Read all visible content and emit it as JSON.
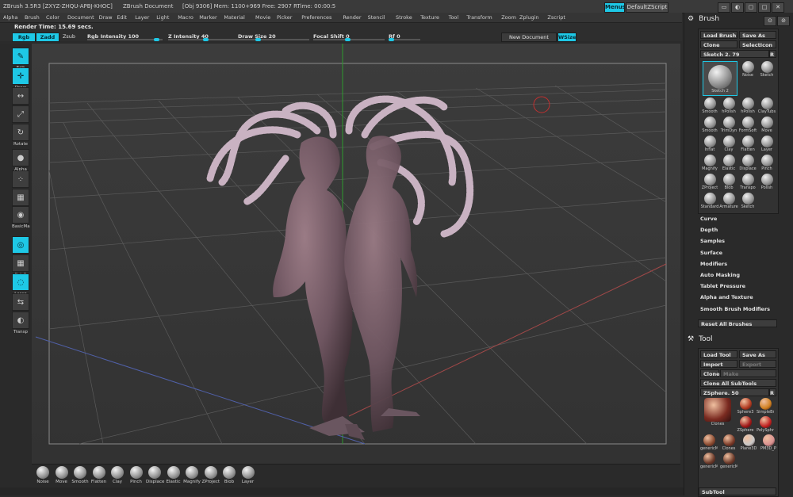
{
  "titlebar": {
    "app": "ZBrush 3.5R3 [ZXYZ-ZHQU-APBJ-KHOC]",
    "doc": "ZBrush Document",
    "stats": "[Obj 9306] Mem: 1100+969 Free: 2907 RTime: 00:00:5",
    "menus_btn": "Menus",
    "script_btn": "DefaultZScript"
  },
  "menubar": [
    "Alpha",
    "Brush",
    "Color",
    "Document",
    "Draw",
    "Edit",
    "Layer",
    "Light",
    "Macro",
    "Marker",
    "Material",
    "Movie",
    "Picker",
    "Preferences",
    "Render",
    "Stencil",
    "Stroke",
    "Texture",
    "Tool",
    "Transform",
    "Zoom",
    "Zplugin",
    "Zscript"
  ],
  "render_time": "Render Time: 15.69 secs.",
  "params": {
    "rgb": "Rgb",
    "zadd": "Zadd",
    "zsub": "Zsub",
    "rgb_intensity": "Rgb Intensity 100",
    "z_intensity": "Z Intensity 40",
    "draw_size": "Draw Size 20",
    "focal_shift": "Focal Shift 0",
    "rf": "Rf 0",
    "new_document": "New Document",
    "wsize": "WSize"
  },
  "lefttools": [
    {
      "label": "Edit",
      "icon": "edit-icon",
      "on": true
    },
    {
      "label": "Draw",
      "icon": "draw-icon",
      "on": true
    },
    {
      "label": "Move",
      "icon": "move-icon",
      "on": false
    },
    {
      "label": "Scale",
      "icon": "scale-icon",
      "on": false
    },
    {
      "label": "Rotate",
      "icon": "rotate-icon",
      "on": false
    },
    {
      "label": "Alpha",
      "icon": "alpha-icon",
      "on": false
    },
    {
      "label": "Dots",
      "icon": "dots-icon",
      "on": false
    },
    {
      "label": "Texture",
      "icon": "texture-icon",
      "on": false
    },
    {
      "label": "BasicMa",
      "icon": "material-icon",
      "on": false
    },
    {
      "label": "Local",
      "icon": "local-icon",
      "on": true
    },
    {
      "label": "PolyF",
      "icon": "polyframe-icon",
      "on": false
    },
    {
      "label": "Lasso",
      "icon": "lasso-icon",
      "on": true
    },
    {
      "label": "L.Sym",
      "icon": "symmetry-icon",
      "on": false
    },
    {
      "label": "Transp",
      "icon": "transparency-icon",
      "on": false
    }
  ],
  "shelf": [
    "Noise",
    "Move",
    "Smooth",
    "Flatten",
    "Clay",
    "Pinch",
    "Displace",
    "Elastic",
    "Magnify",
    "ZProject",
    "Blob",
    "Layer"
  ],
  "brush_panel": {
    "title": "Brush",
    "load": "Load Brush",
    "save": "Save As",
    "clone": "Clone",
    "select_icon": "SelectIcon",
    "sketch_val": "Sketch 2. 79",
    "current": "Sketch 2",
    "grid": [
      "Noise",
      "Sketch",
      "Smooth",
      "hPolish",
      "hPolish",
      "ClayTubs",
      "Smooth",
      "TrimDyn",
      "FormSoft",
      "Move",
      "Inflat",
      "Clay",
      "Flatten",
      "Layer",
      "Magnify",
      "Elastic",
      "Displace",
      "Pinch",
      "ZProject",
      "Blob",
      "Transpo",
      "Polish",
      "Standard",
      "Armature",
      "Sketch"
    ]
  },
  "brush_menu": [
    "Curve",
    "Depth",
    "Samples",
    "Surface",
    "Modifiers",
    "Auto Masking",
    "Tablet Pressure",
    "Alpha and Texture",
    "Smooth Brush Modifiers"
  ],
  "reset_all": "Reset All Brushes",
  "tool_panel": {
    "title": "Tool",
    "load": "Load Tool",
    "save": "Save As",
    "import": "Import",
    "export": "Export",
    "clone": "Clone",
    "make_poly": "Make PolyMesh3D",
    "clone_all": "Clone All SubTools",
    "zsphere": "ZSphere. 50",
    "thumbs": [
      "Clones",
      "Sphere3",
      "SimpleBr",
      "ZSphere",
      "PolySphr",
      "genericM",
      "Clones",
      "Plane3D",
      "PM3D_P",
      "genericM",
      "genericM"
    ],
    "subtool": "SubTool"
  }
}
